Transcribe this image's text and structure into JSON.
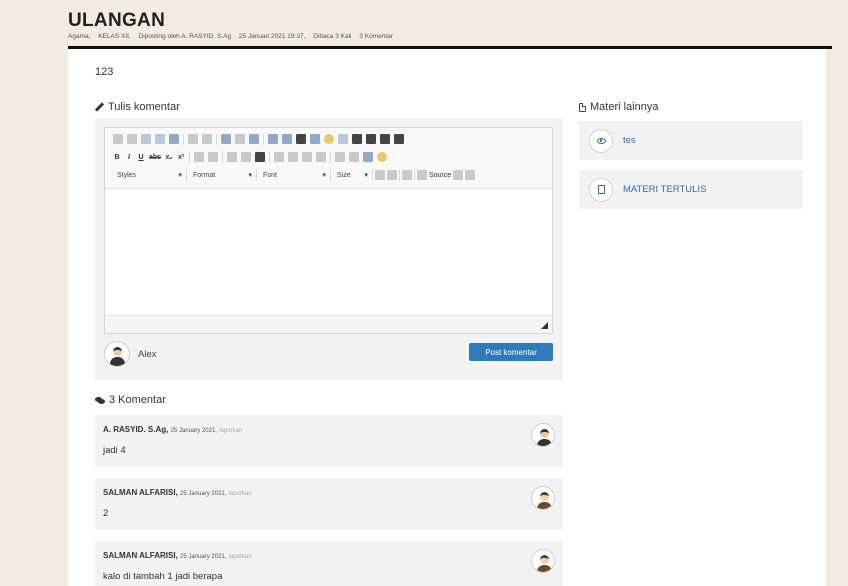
{
  "page": {
    "title": "ULANGAN",
    "meta": {
      "category": "Agama,",
      "class": "KELAS XII,",
      "posted_by": "Diposting oleh A. RASYID. S.Ag",
      "datetime": "25 Januari 2021 19:37,",
      "views": "Dibaca 3 Kali",
      "comments_count": "3 Komentar"
    },
    "post_body": "123"
  },
  "write_comment": {
    "heading": "Tulis komentar",
    "toolbar": {
      "row2_text": [
        "B",
        "I",
        "U",
        "abc",
        "x₂",
        "x²"
      ],
      "styles_label": "Styles",
      "format_label": "Format",
      "font_label": "Font",
      "size_label": "Size",
      "source_label": "Source",
      "combo_arrow": "▾"
    },
    "user_name": "Alex",
    "submit_label": "Post komentar"
  },
  "comments": {
    "heading": "3 Komentar",
    "items": [
      {
        "author": "A. RASYID. S.Ag,",
        "date": "25 January 2021,",
        "report": "laporkan",
        "text": "jadi 4"
      },
      {
        "author": "SALMAN ALFARISI,",
        "date": "25 January 2021,",
        "report": "laporkan",
        "text": "2"
      },
      {
        "author": "SALMAN ALFARISI,",
        "date": "25 January 2021,",
        "report": "laporkan",
        "text": "kalo di tambah 1 jadi berapa"
      }
    ]
  },
  "sidebar": {
    "heading": "Materi lainnya",
    "items": [
      {
        "label": "tes",
        "icon": "eye-icon"
      },
      {
        "label": "MATERI TERTULIS",
        "icon": "file-icon"
      }
    ]
  },
  "colors": {
    "background": "#f3ebe1",
    "primary_button": "#2e7cba",
    "link": "#2e6da4",
    "card": "#f2f2f2"
  }
}
